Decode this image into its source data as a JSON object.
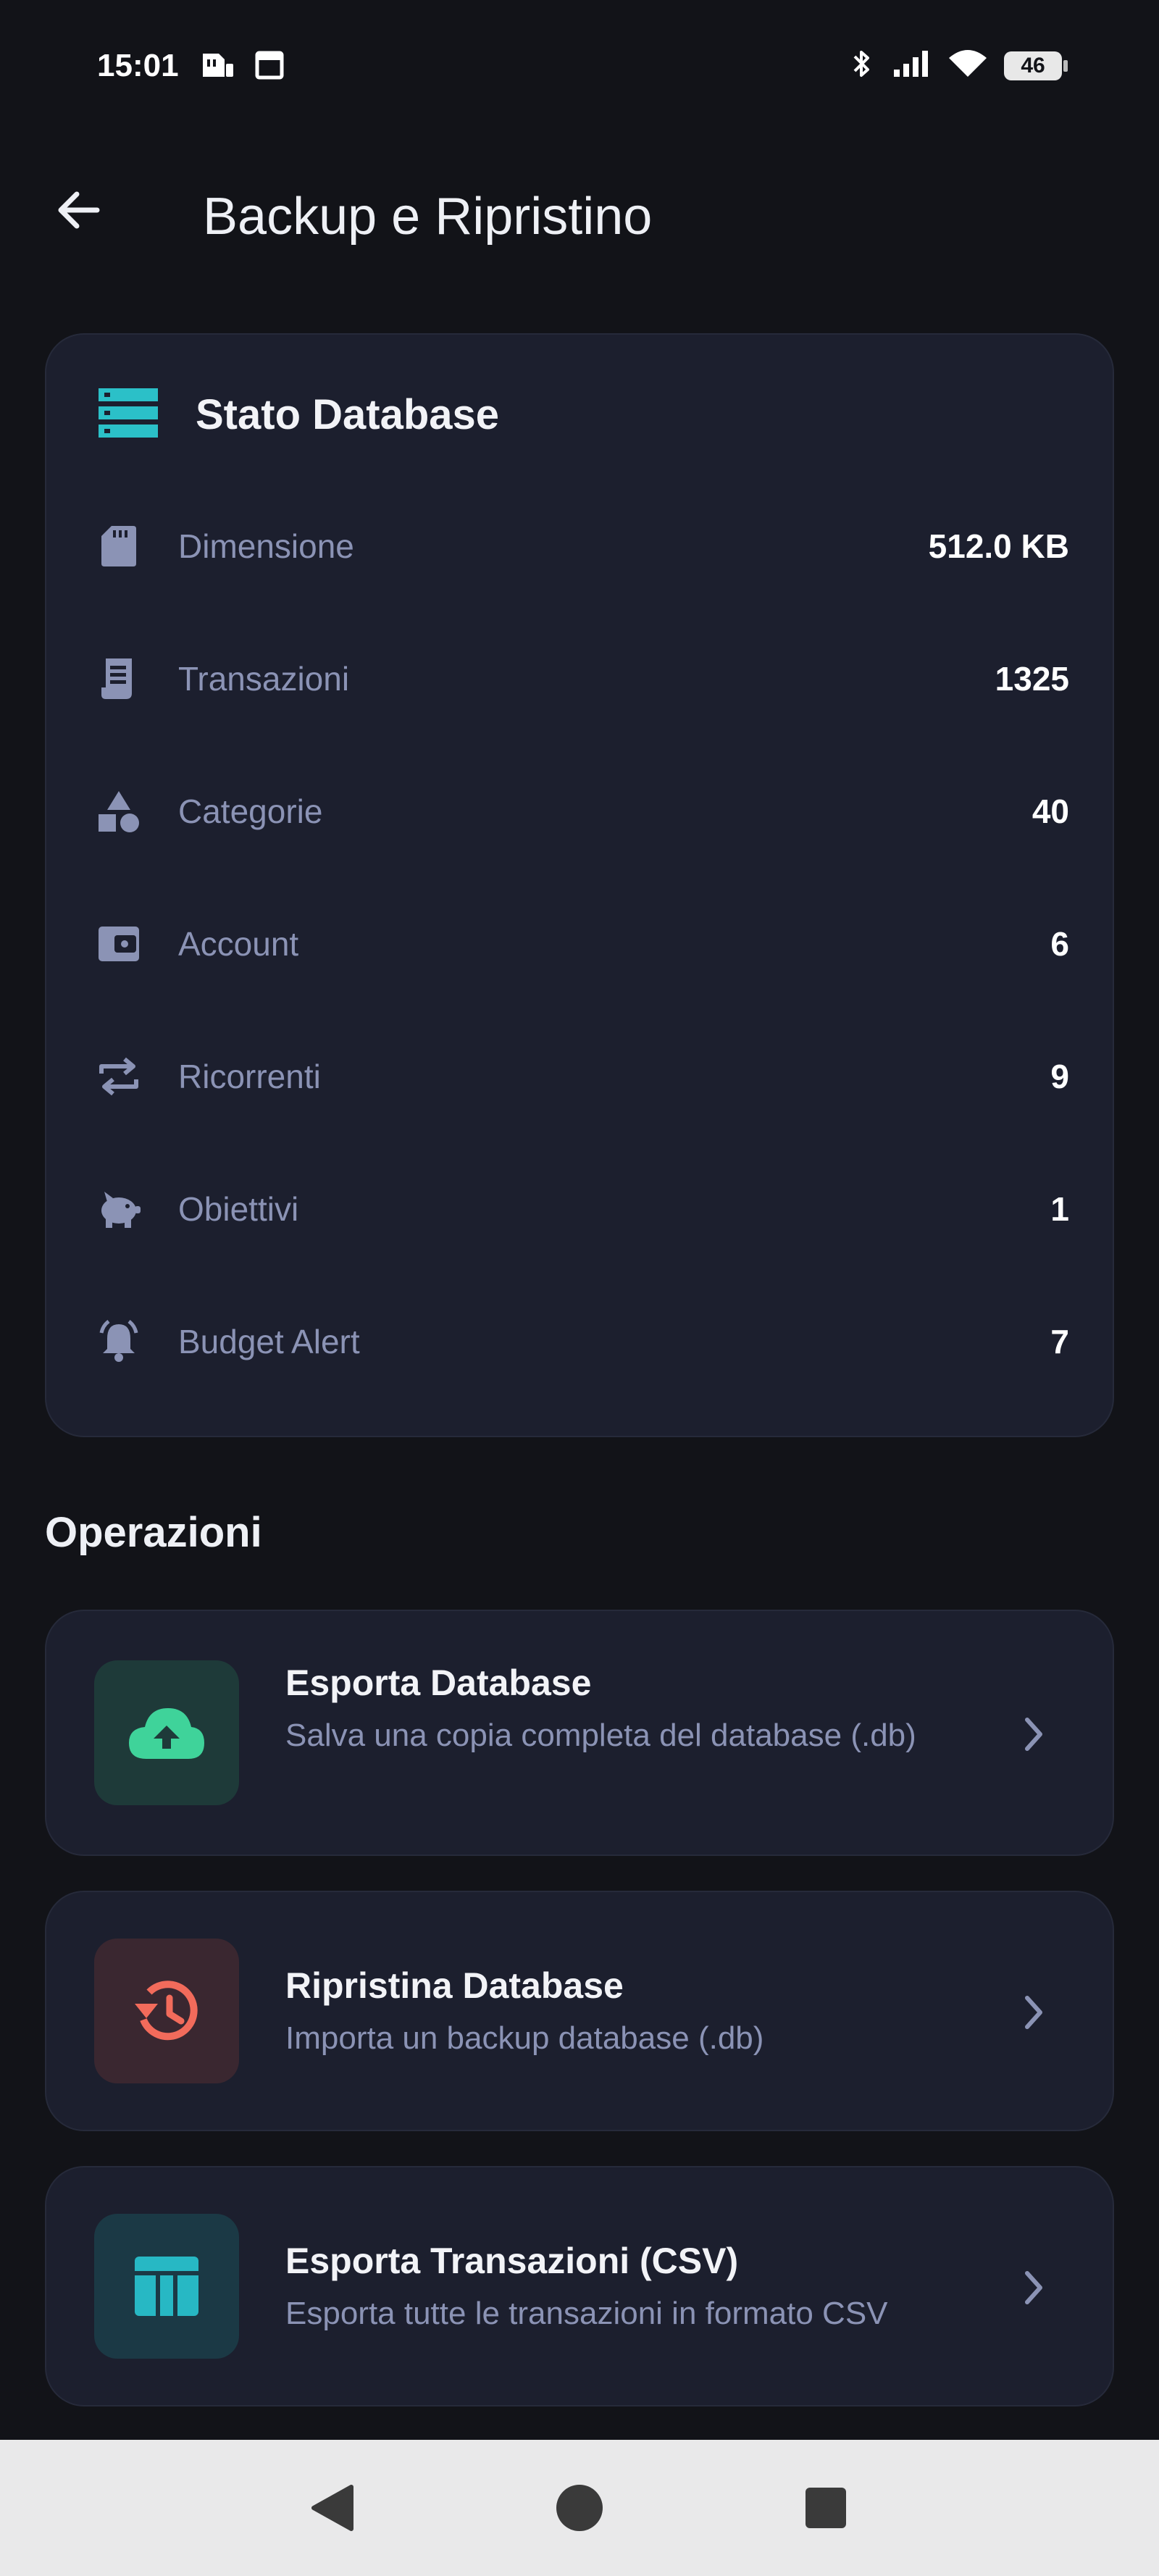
{
  "status_bar": {
    "time": "15:01",
    "battery": "46",
    "icons": [
      "sim-notification-icon",
      "square-notification-icon",
      "bluetooth-icon",
      "signal-icon",
      "wifi-icon",
      "battery-icon"
    ]
  },
  "app_bar": {
    "title": "Backup e Ripristino",
    "back_icon": "arrow-left-icon"
  },
  "db_status": {
    "title": "Stato Database",
    "icon": "storage-icon",
    "accent": "#2bc0c8",
    "rows": [
      {
        "label": "Dimensione",
        "value": "512.0 KB",
        "icon": "sd-card-icon"
      },
      {
        "label": "Transazioni",
        "value": "1325",
        "icon": "receipt-icon"
      },
      {
        "label": "Categorie",
        "value": "40",
        "icon": "category-icon"
      },
      {
        "label": "Account",
        "value": "6",
        "icon": "wallet-icon"
      },
      {
        "label": "Ricorrenti",
        "value": "9",
        "icon": "repeat-icon"
      },
      {
        "label": "Obiettivi",
        "value": "1",
        "icon": "piggy-bank-icon"
      },
      {
        "label": "Budget Alert",
        "value": "7",
        "icon": "alarm-bell-icon"
      }
    ]
  },
  "operations": {
    "title": "Operazioni",
    "items": [
      {
        "title": "Esporta Database",
        "description": "Salva una copia completa del database (.db)",
        "icon": "cloud-upload-icon",
        "color": "#3fd39a"
      },
      {
        "title": "Ripristina Database",
        "description": "Importa un backup database (.db)",
        "icon": "restore-history-icon",
        "color": "#f26b5b"
      },
      {
        "title": "Esporta Transazioni (CSV)",
        "description": "Esporta tutte le transazioni in formato CSV",
        "icon": "table-icon",
        "color": "#27b8c4"
      }
    ]
  },
  "colors": {
    "background": "#121318",
    "card": "#1c1f2e",
    "muted_text": "#8b93b5",
    "nav_bar": "#e9e9ea"
  }
}
